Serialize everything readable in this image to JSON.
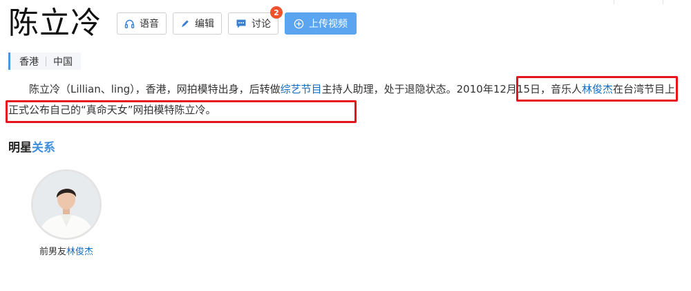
{
  "title": "陈立冷",
  "actions": {
    "voice": "语音",
    "edit": "编辑",
    "discuss": "讨论",
    "discuss_badge": "2",
    "upload": "上传视频"
  },
  "tags": [
    "香港",
    "中国"
  ],
  "intro": {
    "indent": "　　",
    "part1": "陈立冷（Lillian、ling），香港，网拍模特出身，后转做",
    "link1": "综艺节目",
    "part2": "主持人助理，处于退隐状态。",
    "part3": "2010年12月15日，音乐人",
    "link2": "林俊杰",
    "part4": "在台湾节目上正式公布自己的“真命天女”网拍模特陈立冷。"
  },
  "section": {
    "prefix": "明星",
    "accent": "关系"
  },
  "relation": {
    "label": "前男友",
    "name": "林俊杰"
  },
  "colors": {
    "link": "#136ec2",
    "highlight": "#e8141c",
    "primary": "#5aa4f0",
    "badge": "#f0522e"
  }
}
